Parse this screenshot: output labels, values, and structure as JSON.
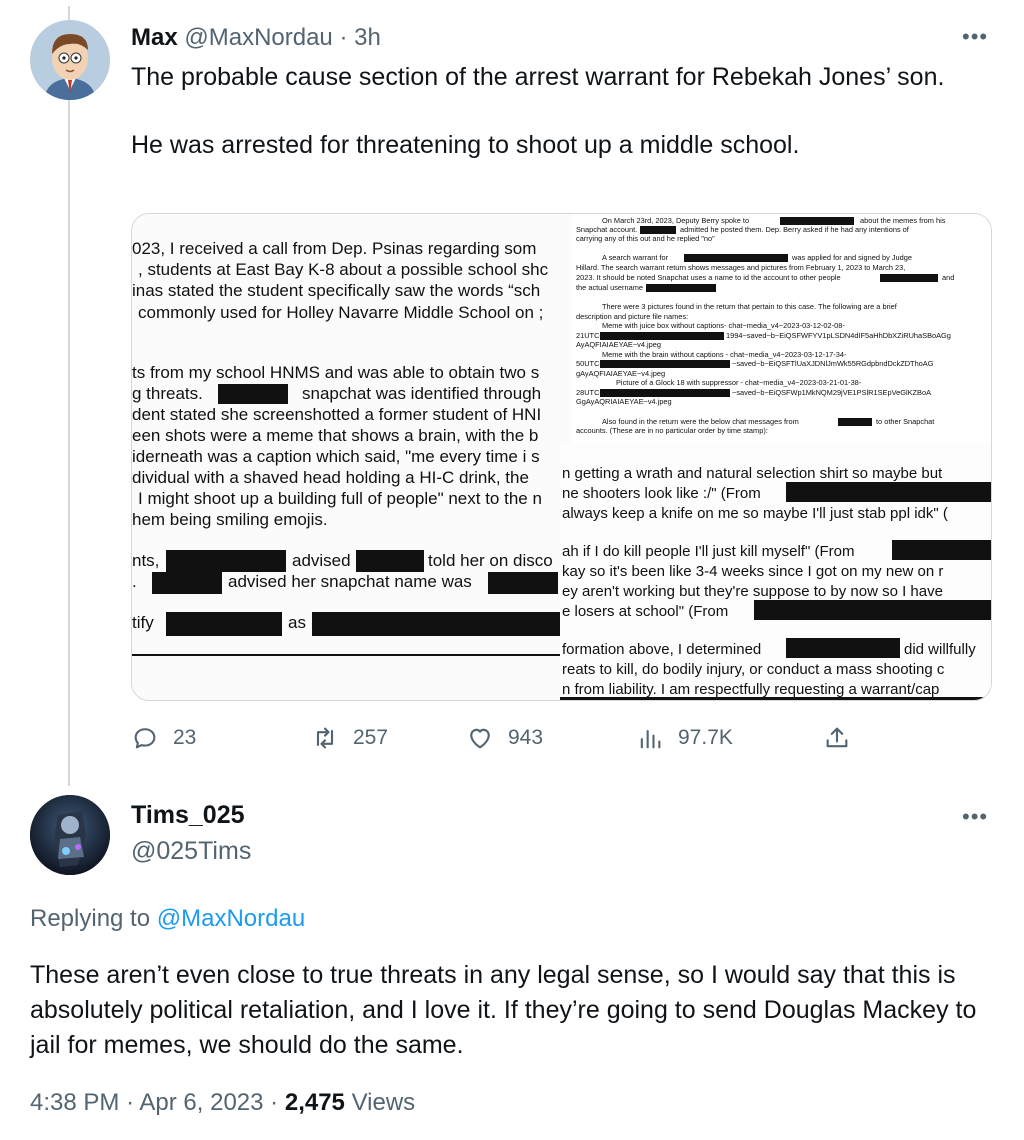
{
  "parent_tweet": {
    "display_name": "Max",
    "handle": "@MaxNordau",
    "separator": "·",
    "time_ago": "3h",
    "text_line1": "The probable cause section of the arrest warrant for Rebekah Jones’ son.",
    "text_line2": "He was arrested for threatening to shoot up a middle school.",
    "media": {
      "left_doc": [
        "023, I received a call from Dep. Psinas regarding som",
        ", students at East Bay K-8 about a possible school shc",
        "inas stated the student specifically saw the words “sch",
        "commonly used for Holley Navarre Middle School on ;",
        "ts from my school HNMS and was able to obtain two s",
        "g threats.",
        "snapchat was identified through",
        "dent stated she screenshotted a former student of HNI",
        "een shots were a meme that shows a brain, with the b",
        "iderneath was a caption which said, \"me every time i s",
        "dividual with a shaved head holding a HI-C drink, the",
        "I might shoot up a building full of people\" next to the n",
        "hem being smiling emojis.",
        "nts,",
        "advised",
        "told her on disco",
        "advised her snapchat name was",
        "tify",
        "as"
      ],
      "right_doc": [
        "On March 23rd, 2023, Deputy Berry spoke to",
        "about the memes from his",
        "Snapchat account.",
        "admitted he posted them. Dep. Berry asked if he had any intentions of",
        "carrying any of this out and he replied \"no\"",
        "A search warrant for",
        "was applied for and signed by Judge",
        "Hillard. The search warrant return shows messages and pictures from February 1, 2023 to March 23,",
        "2023. It should be noted Snapchat uses a name to id the account to other people",
        "and",
        "the actual username",
        "There were 3 pictures found in the return that pertain to this case. The following are a brief",
        "description and picture file names:",
        "Meme with juice box without captions- chat~media_v4~2023-03-12-02-08-",
        "21UTC~",
        "1994~saved~b~EiQSFWFYV1pLSDN4dIF5aHhDbXZiRUhaSBoAGg",
        "AyAQFIAIAEYAE~v4.jpeg",
        "Meme with the brain without captions - chat~media_v4~2023-03-12-17-34-",
        "50UTC~",
        "~saved~b~EiQSFTlUaXJDNlJmWk55RGdpbndDckZDThoAG",
        "gAyAQFIAIAEYAE~v4.jpeg",
        "Picture of a Glock 18 with suppressor - chat~media_v4~2023-03-21-01-38-",
        "28UTC~",
        "~saved~b~EiQSFWp1MkNQM29jVE1PSlR1SEpVeGlKZBoA",
        "GgAyAQRIAIAEYAE~v4.jpeg",
        "Also found in the return were the below chat messages from",
        "to other Snapchat",
        "accounts. (These are in no particular order by time stamp):"
      ],
      "overlay_doc": [
        "n getting a wrath and natural selection shirt so maybe but",
        "ne shooters look like :/\" (From",
        "always keep a knife on me so maybe I'll just stab ppl idk\" (",
        "ah if I do kill people I'll just kill myself\" (From",
        "kay so it's been like 3-4 weeks since I got on my new on r",
        "ey aren't working but they're suppose to by now so I have",
        "e losers at school\" (From",
        "formation above, I determined",
        "did willfully",
        "reats to kill, do bodily injury, or conduct a mass shooting c",
        "n from liability.  I am respectfully requesting a warrant/cap"
      ]
    },
    "actions": {
      "replies": "23",
      "retweets": "257",
      "likes": "943",
      "views": "97.7K"
    },
    "more_icon": "more-horizontal-icon"
  },
  "reply_tweet": {
    "display_name": "Tims_025",
    "handle": "@025Tims",
    "replying_prefix": "Replying to",
    "replying_to": "@MaxNordau",
    "text": "These aren’t even close to true threats in any legal sense, so I would say that this is absolutely political retaliation, and I love it. If they’re going to send Douglas Mackey to jail for memes, we should do the same.",
    "time": "4:38 PM",
    "separator": "·",
    "date": "Apr 6, 2023",
    "view_count": "2,475",
    "views_label": "Views",
    "more_icon": "more-horizontal-icon"
  },
  "colors": {
    "text_primary": "#0f1419",
    "text_secondary": "#536471",
    "link": "#1d9bf0",
    "thread_line": "#cfd9de"
  }
}
